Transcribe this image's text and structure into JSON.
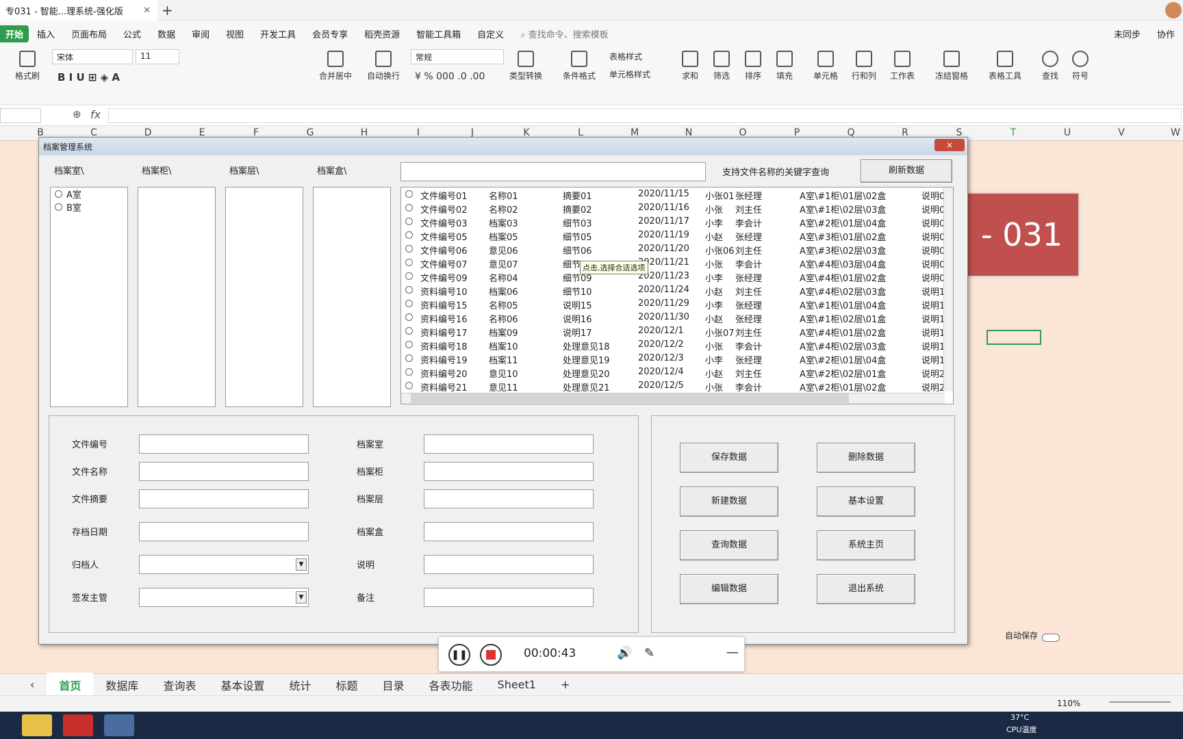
{
  "window": {
    "doc_tab": "专031 - 智能...理系统-强化版"
  },
  "menu": [
    "开始",
    "插入",
    "页面布局",
    "公式",
    "数据",
    "审阅",
    "视图",
    "开发工具",
    "会员专享",
    "稻壳资源",
    "智能工具箱",
    "自定义"
  ],
  "menu_search": "查找命令、搜索模板",
  "menu_right": {
    "sync": "未同步",
    "collab": "协作"
  },
  "ribbon": {
    "format_painter": "格式刷",
    "font_name": "宋体",
    "font_size": "11",
    "merge": "合并居中",
    "wrap": "自动换行",
    "number_format": "常规",
    "type_convert": "类型转换",
    "cond_format": "条件格式",
    "table_style": "表格样式",
    "cell_style": "单元格样式",
    "sum": "求和",
    "filter": "筛选",
    "sort": "排序",
    "fill": "填充",
    "cell": "单元格",
    "rowcol": "行和列",
    "worksheet": "工作表",
    "freeze": "冻结窗格",
    "table_tools": "表格工具",
    "find": "查找",
    "symbol": "符号"
  },
  "formula": {
    "fx": "fx"
  },
  "columns": [
    "B",
    "C",
    "D",
    "E",
    "F",
    "G",
    "H",
    "I",
    "J",
    "K",
    "L",
    "M",
    "N",
    "O",
    "P",
    "Q",
    "R",
    "S",
    "T",
    "U",
    "V",
    "W"
  ],
  "banner": "- 031",
  "dialog": {
    "title": "档案管理系统",
    "close": "×",
    "headers": {
      "room": "档案室\\",
      "cabinet": "档案柜\\",
      "layer": "档案层\\",
      "box": "档案盒\\"
    },
    "rooms": [
      "A室",
      "B室"
    ],
    "search_hint": "支持文件名称的关键字查询",
    "refresh": "刷新数据",
    "tooltip": "点击,选择合适选项",
    "records": [
      [
        "文件编号01",
        "名称01",
        "摘要01",
        "2020/11/15",
        "小张01",
        "张经理",
        "A室\\#1柜\\01层\\02盒",
        "说明0"
      ],
      [
        "文件编号02",
        "名称02",
        "摘要02",
        "2020/11/16",
        "小张",
        "刘主任",
        "A室\\#1柜\\02层\\03盒",
        "说明0"
      ],
      [
        "文件编号03",
        "档案03",
        "细节03",
        "2020/11/17",
        "小李",
        "李会计",
        "A室\\#2柜\\01层\\04盒",
        "说明0"
      ],
      [
        "文件编号05",
        "档案05",
        "细节05",
        "2020/11/19",
        "小赵",
        "张经理",
        "A室\\#3柜\\01层\\02盒",
        "说明0"
      ],
      [
        "文件编号06",
        "意见06",
        "细节06",
        "2020/11/20",
        "小张06",
        "刘主任",
        "A室\\#3柜\\02层\\03盒",
        "说明0"
      ],
      [
        "文件编号07",
        "意见07",
        "细节07",
        "2020/11/21",
        "小张",
        "李会计",
        "A室\\#4柜\\03层\\04盒",
        "说明0"
      ],
      [
        "文件编号09",
        "名称04",
        "细节09",
        "2020/11/23",
        "小李",
        "张经理",
        "A室\\#4柜\\01层\\02盒",
        "说明0"
      ],
      [
        "资料编号10",
        "档案06",
        "细节10",
        "2020/11/24",
        "小赵",
        "刘主任",
        "A室\\#4柜\\02层\\03盒",
        "说明1"
      ],
      [
        "资料编号15",
        "名称05",
        "说明15",
        "2020/11/29",
        "小李",
        "张经理",
        "A室\\#1柜\\01层\\04盒",
        "说明1"
      ],
      [
        "资料编号16",
        "名称06",
        "说明16",
        "2020/11/30",
        "小赵",
        "张经理",
        "A室\\#1柜\\02层\\01盒",
        "说明1"
      ],
      [
        "资料编号17",
        "档案09",
        "说明17",
        "2020/12/1",
        "小张07",
        "刘主任",
        "A室\\#4柜\\01层\\02盒",
        "说明1"
      ],
      [
        "资料编号18",
        "档案10",
        "处理意见18",
        "2020/12/2",
        "小张",
        "李会计",
        "A室\\#4柜\\02层\\03盒",
        "说明1"
      ],
      [
        "资料编号19",
        "档案11",
        "处理意见19",
        "2020/12/3",
        "小李",
        "张经理",
        "A室\\#2柜\\01层\\04盒",
        "说明1"
      ],
      [
        "资料编号20",
        "意见10",
        "处理意见20",
        "2020/12/4",
        "小赵",
        "刘主任",
        "A室\\#2柜\\02层\\01盒",
        "说明2"
      ],
      [
        "资料编号21",
        "意见11",
        "处理意见21",
        "2020/12/5",
        "小张",
        "李会计",
        "A室\\#2柜\\01层\\02盒",
        "说明2"
      ]
    ],
    "form_left": [
      "文件编号",
      "文件名称",
      "文件摘要",
      "存档日期",
      "归档人",
      "签发主管"
    ],
    "form_right": [
      "档案室",
      "档案柜",
      "档案层",
      "档案盒",
      "说明",
      "备注"
    ],
    "buttons": [
      [
        "保存数据",
        "删除数据"
      ],
      [
        "新建数据",
        "基本设置"
      ],
      [
        "查询数据",
        "系统主页"
      ],
      [
        "编辑数据",
        "退出系统"
      ]
    ]
  },
  "recorder": {
    "time": "00:00:43"
  },
  "autosave": "自动保存",
  "sheets": [
    "首页",
    "数据库",
    "查询表",
    "基本设置",
    "统计",
    "标题",
    "目录",
    "各表功能",
    "Sheet1"
  ],
  "status": {
    "zoom": "110%",
    "temp": "37°C",
    "cpu": "CPU温度"
  }
}
